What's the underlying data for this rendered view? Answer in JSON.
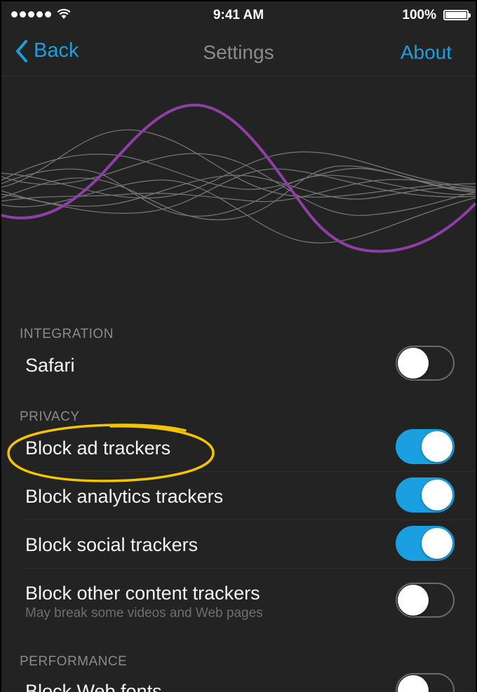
{
  "status_bar": {
    "time": "9:41 AM",
    "battery_percent": "100%",
    "signal_bars": 5,
    "wifi_icon": "wifi-icon",
    "battery_icon": "battery-icon"
  },
  "nav": {
    "back_label": "Back",
    "title": "Settings",
    "about_label": "About",
    "back_icon": "chevron-left-icon",
    "accent_color": "#1a9fe0"
  },
  "graphic": {
    "highlight_wave_color": "#8e3fa6",
    "background_wave_color": "#bdbdbd"
  },
  "sections": {
    "integration": {
      "header": "INTEGRATION",
      "items": [
        {
          "label": "Safari",
          "enabled": false
        }
      ]
    },
    "privacy": {
      "header": "PRIVACY",
      "items": [
        {
          "label": "Block ad trackers",
          "enabled": true
        },
        {
          "label": "Block analytics trackers",
          "enabled": true
        },
        {
          "label": "Block social trackers",
          "enabled": true
        },
        {
          "label": "Block other content trackers",
          "sublabel": "May break some videos and Web pages",
          "enabled": false
        }
      ]
    },
    "performance": {
      "header": "PERFORMANCE",
      "items": [
        {
          "label": "Block Web fonts",
          "enabled": false
        }
      ]
    }
  },
  "annotation": {
    "highlight_color": "#f5c400",
    "highlighted_item": "Block ad trackers"
  }
}
